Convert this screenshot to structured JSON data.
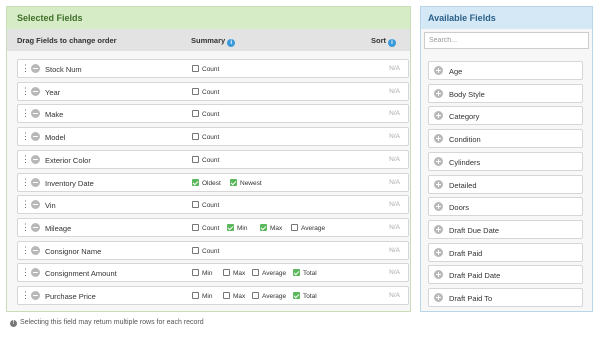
{
  "selected": {
    "title": "Selected Fields",
    "headers": {
      "drag": "Drag Fields to change order",
      "summary": "Summary",
      "sort": "Sort",
      "info_glyph": "i"
    },
    "rows": [
      {
        "name": "Stock Num",
        "sort": "N/A",
        "options": [
          {
            "label": "Count",
            "checked": false
          }
        ]
      },
      {
        "name": "Year",
        "sort": "N/A",
        "options": [
          {
            "label": "Count",
            "checked": false
          }
        ]
      },
      {
        "name": "Make",
        "sort": "N/A",
        "options": [
          {
            "label": "Count",
            "checked": false
          }
        ]
      },
      {
        "name": "Model",
        "sort": "N/A",
        "options": [
          {
            "label": "Count",
            "checked": false
          }
        ]
      },
      {
        "name": "Exterior Color",
        "sort": "N/A",
        "options": [
          {
            "label": "Count",
            "checked": false
          }
        ]
      },
      {
        "name": "Inventory Date",
        "sort": "N/A",
        "options": [
          {
            "label": "Oldest",
            "checked": true
          },
          {
            "label": "Newest",
            "checked": true
          }
        ]
      },
      {
        "name": "Vin",
        "sort": "N/A",
        "options": [
          {
            "label": "Count",
            "checked": false
          }
        ]
      },
      {
        "name": "Mileage",
        "sort": "N/A",
        "options": [
          {
            "label": "Count",
            "checked": false
          },
          {
            "label": "Min",
            "checked": true
          },
          {
            "label": "Max",
            "checked": true
          },
          {
            "label": "Average",
            "checked": false
          }
        ]
      },
      {
        "name": "Consignor Name",
        "sort": "N/A",
        "options": [
          {
            "label": "Count",
            "checked": false
          }
        ]
      },
      {
        "name": "Consignment Amount",
        "sort": "N/A",
        "options": [
          {
            "label": "Min",
            "checked": false
          },
          {
            "label": "Max",
            "checked": false
          },
          {
            "label": "Average",
            "checked": false
          },
          {
            "label": "Total",
            "checked": true
          }
        ]
      },
      {
        "name": "Purchase Price",
        "sort": "N/A",
        "options": [
          {
            "label": "Min",
            "checked": false
          },
          {
            "label": "Max",
            "checked": false
          },
          {
            "label": "Average",
            "checked": false
          },
          {
            "label": "Total",
            "checked": true
          }
        ]
      }
    ],
    "footnote": "Selecting this field may return multiple rows for each record",
    "footnote_glyph": "!"
  },
  "available": {
    "title": "Available Fields",
    "search_placeholder": "Search...",
    "items": [
      "Age",
      "Body Style",
      "Category",
      "Condition",
      "Cylinders",
      "Detailed",
      "Doors",
      "Draft Due Date",
      "Draft Paid",
      "Draft Paid Date",
      "Draft Paid To"
    ]
  },
  "colors": {
    "selected_header": "#d6ecc6",
    "available_header": "#d5e8f5",
    "check": "#5cb85c",
    "info": "#3a9ad9"
  },
  "icons": {
    "drag": "drag-handle-icon",
    "remove": "minus-circle-icon",
    "add": "plus-circle-icon",
    "info": "info-icon",
    "warning": "exclamation-circle-icon"
  }
}
